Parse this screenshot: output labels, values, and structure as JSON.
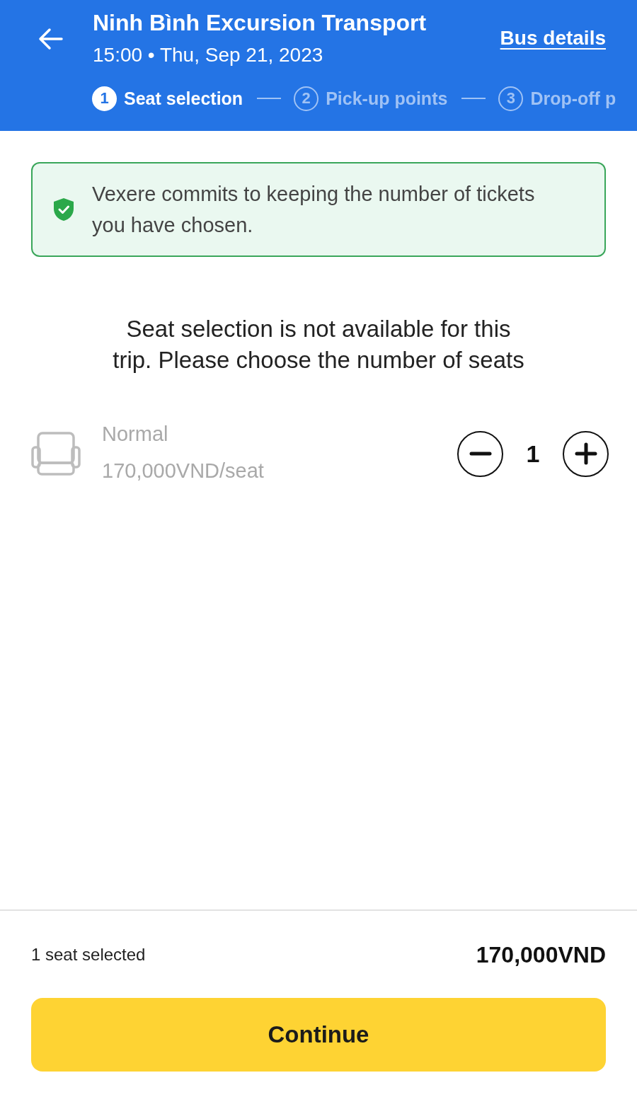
{
  "header": {
    "title": "Ninh Bình Excursion Transport",
    "subtitle": "15:00 • Thu, Sep 21, 2023",
    "link": "Bus details"
  },
  "steps": [
    {
      "number": "1",
      "label": "Seat selection",
      "selected": true
    },
    {
      "number": "2",
      "label": "Pick-up points",
      "selected": false
    },
    {
      "number": "3",
      "label": "Drop-off p",
      "selected": false
    }
  ],
  "notice": {
    "text": "Vexere commits to keeping the number of tickets you have chosen."
  },
  "message": "Seat selection is not available for this trip. Please choose the number of seats",
  "seat_type": {
    "name": "Normal",
    "price": "170,000VND/seat",
    "quantity": "1"
  },
  "footer": {
    "summary": "1 seat selected",
    "total": "170,000VND",
    "button": "Continue"
  }
}
